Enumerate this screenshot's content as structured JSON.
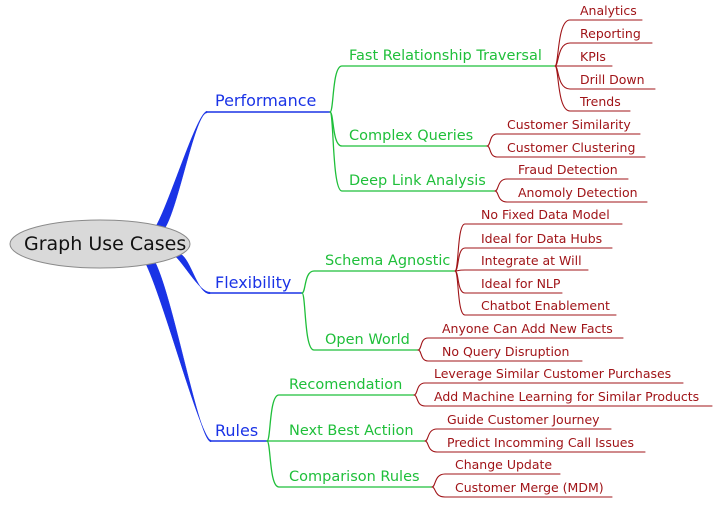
{
  "title": "Graph Use Cases",
  "colors": {
    "root_fill": "#d9d9d9",
    "root_stroke": "#8a8a8a",
    "level1": "#1a33e6",
    "level2": "#1fbf3a",
    "level3": "#a01418"
  },
  "branches": [
    {
      "label": "Performance",
      "children": [
        {
          "label": "Fast Relationship Traversal",
          "children": [
            "Analytics",
            "Reporting",
            "KPIs",
            "Drill Down",
            "Trends"
          ]
        },
        {
          "label": "Complex Queries",
          "children": [
            "Customer Similarity",
            "Customer Clustering"
          ]
        },
        {
          "label": "Deep Link Analysis",
          "children": [
            "Fraud Detection",
            "Anomoly Detection"
          ]
        }
      ]
    },
    {
      "label": "Flexibility",
      "children": [
        {
          "label": "Schema Agnostic",
          "children": [
            "No Fixed Data Model",
            "Ideal for Data Hubs",
            "Integrate at Will",
            "Ideal for NLP",
            "Chatbot Enablement"
          ]
        },
        {
          "label": "Open World",
          "children": [
            "Anyone Can Add New Facts",
            "No Query Disruption"
          ]
        }
      ]
    },
    {
      "label": "Rules",
      "children": [
        {
          "label": "Recomendation",
          "children": [
            "Leverage Similar Customer Purchases",
            "Add Machine Learning for Similar Products"
          ]
        },
        {
          "label": "Next Best Actiion",
          "children": [
            "Guide Customer Journey",
            "Predict Incomming Call Issues"
          ]
        },
        {
          "label": "Comparison Rules",
          "children": [
            "Change Update",
            "Customer Merge (MDM)"
          ]
        }
      ]
    }
  ]
}
